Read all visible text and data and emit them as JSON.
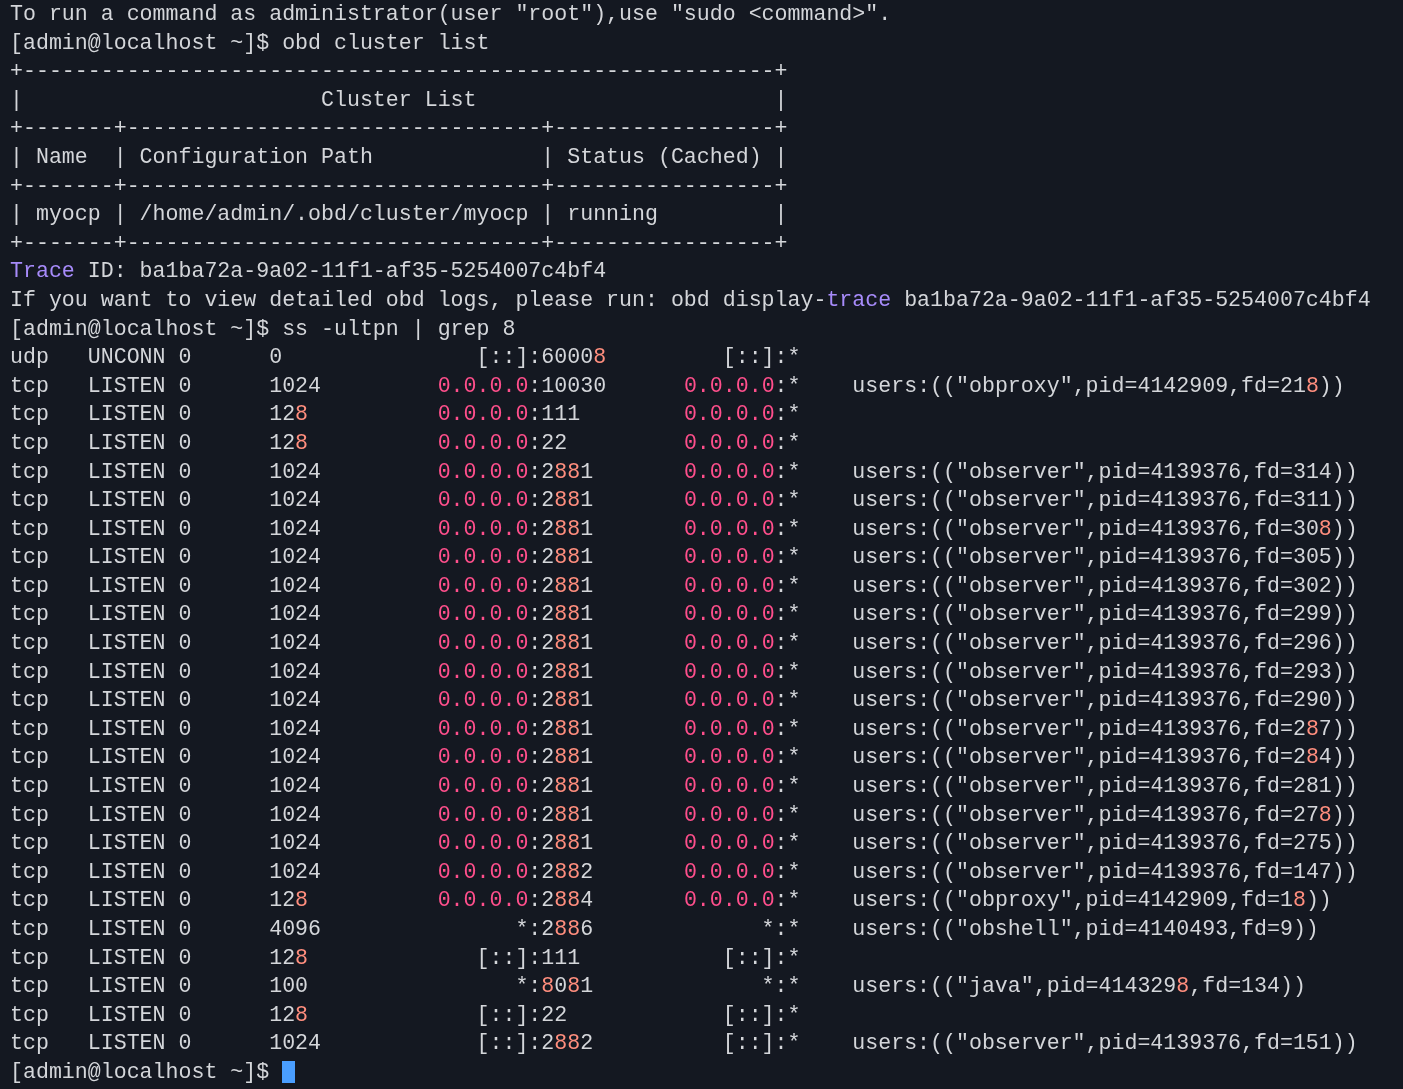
{
  "terminal": {
    "lines": [
      {
        "segments": [
          {
            "kind": "plain",
            "text": "To run a command as administrator(user \"root\"),use \"sudo <command>\"."
          }
        ]
      },
      {
        "segments": [
          {
            "kind": "plain",
            "text": "[admin@localhost ~]$ obd cluster list"
          }
        ]
      },
      {
        "segments": [
          {
            "kind": "plain",
            "text": "+----------------------------------------------------------+"
          }
        ]
      },
      {
        "segments": [
          {
            "kind": "plain",
            "text": "|                       Cluster List                       |"
          }
        ]
      },
      {
        "segments": [
          {
            "kind": "plain",
            "text": "+-------+--------------------------------+-----------------+"
          }
        ]
      },
      {
        "segments": [
          {
            "kind": "plain",
            "text": "| Name  | Configuration Path             | Status (Cached) |"
          }
        ]
      },
      {
        "segments": [
          {
            "kind": "plain",
            "text": "+-------+--------------------------------+-----------------+"
          }
        ]
      },
      {
        "segments": [
          {
            "kind": "plain",
            "text": "| myocp | /home/admin/.obd/cluster/myocp | running         |"
          }
        ]
      },
      {
        "segments": [
          {
            "kind": "plain",
            "text": "+-------+--------------------------------+-----------------+"
          }
        ]
      },
      {
        "segments": [
          {
            "kind": "keyword",
            "text": "Trace"
          },
          {
            "kind": "plain",
            "text": " ID: ba1ba72a-9a02-11f1-af35-5254007c4bf4"
          }
        ]
      },
      {
        "segments": [
          {
            "kind": "plain",
            "text": "If you want to view detailed obd logs, please run: obd display-"
          },
          {
            "kind": "keyword",
            "text": "trace"
          },
          {
            "kind": "plain",
            "text": " ba1ba72a-9a02-11f1-af35-5254007c4bf4"
          }
        ]
      },
      {
        "segments": [
          {
            "kind": "plain",
            "text": "[admin@localhost ~]$ ss -ultpn | grep 8"
          }
        ]
      },
      {
        "segments": [
          {
            "kind": "plain",
            "text": "udp   UNCONN 0      0               [::]:6000"
          },
          {
            "kind": "match",
            "text": "8"
          },
          {
            "kind": "plain",
            "text": "         [::]:*"
          }
        ]
      },
      {
        "segments": [
          {
            "kind": "plain",
            "text": "tcp   LISTEN 0      1024         "
          },
          {
            "kind": "ip",
            "text": "0.0.0.0"
          },
          {
            "kind": "plain",
            "text": ":10030      "
          },
          {
            "kind": "ip",
            "text": "0.0.0.0"
          },
          {
            "kind": "plain",
            "text": ":*    users:((\"obproxy\",pid=4142909,fd=21"
          },
          {
            "kind": "match",
            "text": "8"
          },
          {
            "kind": "plain",
            "text": "))"
          }
        ]
      },
      {
        "segments": [
          {
            "kind": "plain",
            "text": "tcp   LISTEN 0      12"
          },
          {
            "kind": "match",
            "text": "8"
          },
          {
            "kind": "ip",
            "text": "          0.0.0.0"
          },
          {
            "kind": "plain",
            "text": ":111        "
          },
          {
            "kind": "ip",
            "text": "0.0.0.0"
          },
          {
            "kind": "plain",
            "text": ":*"
          }
        ]
      },
      {
        "segments": [
          {
            "kind": "plain",
            "text": "tcp   LISTEN 0      12"
          },
          {
            "kind": "match",
            "text": "8"
          },
          {
            "kind": "ip",
            "text": "          0.0.0.0"
          },
          {
            "kind": "plain",
            "text": ":22         "
          },
          {
            "kind": "ip",
            "text": "0.0.0.0"
          },
          {
            "kind": "plain",
            "text": ":*"
          }
        ]
      },
      {
        "segments": [
          {
            "kind": "plain",
            "text": "tcp   LISTEN 0      1024         "
          },
          {
            "kind": "ip",
            "text": "0.0.0.0"
          },
          {
            "kind": "plain",
            "text": ":2"
          },
          {
            "kind": "match",
            "text": "88"
          },
          {
            "kind": "plain",
            "text": "1       "
          },
          {
            "kind": "ip",
            "text": "0.0.0.0"
          },
          {
            "kind": "plain",
            "text": ":*    users:((\"observer\",pid=4139376,fd=314))"
          }
        ]
      },
      {
        "segments": [
          {
            "kind": "plain",
            "text": "tcp   LISTEN 0      1024         "
          },
          {
            "kind": "ip",
            "text": "0.0.0.0"
          },
          {
            "kind": "plain",
            "text": ":2"
          },
          {
            "kind": "match",
            "text": "88"
          },
          {
            "kind": "plain",
            "text": "1       "
          },
          {
            "kind": "ip",
            "text": "0.0.0.0"
          },
          {
            "kind": "plain",
            "text": ":*    users:((\"observer\",pid=4139376,fd=311))"
          }
        ]
      },
      {
        "segments": [
          {
            "kind": "plain",
            "text": "tcp   LISTEN 0      1024         "
          },
          {
            "kind": "ip",
            "text": "0.0.0.0"
          },
          {
            "kind": "plain",
            "text": ":2"
          },
          {
            "kind": "match",
            "text": "88"
          },
          {
            "kind": "plain",
            "text": "1       "
          },
          {
            "kind": "ip",
            "text": "0.0.0.0"
          },
          {
            "kind": "plain",
            "text": ":*    users:((\"observer\",pid=4139376,fd=30"
          },
          {
            "kind": "match",
            "text": "8"
          },
          {
            "kind": "plain",
            "text": "))"
          }
        ]
      },
      {
        "segments": [
          {
            "kind": "plain",
            "text": "tcp   LISTEN 0      1024         "
          },
          {
            "kind": "ip",
            "text": "0.0.0.0"
          },
          {
            "kind": "plain",
            "text": ":2"
          },
          {
            "kind": "match",
            "text": "88"
          },
          {
            "kind": "plain",
            "text": "1       "
          },
          {
            "kind": "ip",
            "text": "0.0.0.0"
          },
          {
            "kind": "plain",
            "text": ":*    users:((\"observer\",pid=4139376,fd=305))"
          }
        ]
      },
      {
        "segments": [
          {
            "kind": "plain",
            "text": "tcp   LISTEN 0      1024         "
          },
          {
            "kind": "ip",
            "text": "0.0.0.0"
          },
          {
            "kind": "plain",
            "text": ":2"
          },
          {
            "kind": "match",
            "text": "88"
          },
          {
            "kind": "plain",
            "text": "1       "
          },
          {
            "kind": "ip",
            "text": "0.0.0.0"
          },
          {
            "kind": "plain",
            "text": ":*    users:((\"observer\",pid=4139376,fd=302))"
          }
        ]
      },
      {
        "segments": [
          {
            "kind": "plain",
            "text": "tcp   LISTEN 0      1024         "
          },
          {
            "kind": "ip",
            "text": "0.0.0.0"
          },
          {
            "kind": "plain",
            "text": ":2"
          },
          {
            "kind": "match",
            "text": "88"
          },
          {
            "kind": "plain",
            "text": "1       "
          },
          {
            "kind": "ip",
            "text": "0.0.0.0"
          },
          {
            "kind": "plain",
            "text": ":*    users:((\"observer\",pid=4139376,fd=299))"
          }
        ]
      },
      {
        "segments": [
          {
            "kind": "plain",
            "text": "tcp   LISTEN 0      1024         "
          },
          {
            "kind": "ip",
            "text": "0.0.0.0"
          },
          {
            "kind": "plain",
            "text": ":2"
          },
          {
            "kind": "match",
            "text": "88"
          },
          {
            "kind": "plain",
            "text": "1       "
          },
          {
            "kind": "ip",
            "text": "0.0.0.0"
          },
          {
            "kind": "plain",
            "text": ":*    users:((\"observer\",pid=4139376,fd=296))"
          }
        ]
      },
      {
        "segments": [
          {
            "kind": "plain",
            "text": "tcp   LISTEN 0      1024         "
          },
          {
            "kind": "ip",
            "text": "0.0.0.0"
          },
          {
            "kind": "plain",
            "text": ":2"
          },
          {
            "kind": "match",
            "text": "88"
          },
          {
            "kind": "plain",
            "text": "1       "
          },
          {
            "kind": "ip",
            "text": "0.0.0.0"
          },
          {
            "kind": "plain",
            "text": ":*    users:((\"observer\",pid=4139376,fd=293))"
          }
        ]
      },
      {
        "segments": [
          {
            "kind": "plain",
            "text": "tcp   LISTEN 0      1024         "
          },
          {
            "kind": "ip",
            "text": "0.0.0.0"
          },
          {
            "kind": "plain",
            "text": ":2"
          },
          {
            "kind": "match",
            "text": "88"
          },
          {
            "kind": "plain",
            "text": "1       "
          },
          {
            "kind": "ip",
            "text": "0.0.0.0"
          },
          {
            "kind": "plain",
            "text": ":*    users:((\"observer\",pid=4139376,fd=290))"
          }
        ]
      },
      {
        "segments": [
          {
            "kind": "plain",
            "text": "tcp   LISTEN 0      1024         "
          },
          {
            "kind": "ip",
            "text": "0.0.0.0"
          },
          {
            "kind": "plain",
            "text": ":2"
          },
          {
            "kind": "match",
            "text": "88"
          },
          {
            "kind": "plain",
            "text": "1       "
          },
          {
            "kind": "ip",
            "text": "0.0.0.0"
          },
          {
            "kind": "plain",
            "text": ":*    users:((\"observer\",pid=4139376,fd=2"
          },
          {
            "kind": "match",
            "text": "8"
          },
          {
            "kind": "plain",
            "text": "7))"
          }
        ]
      },
      {
        "segments": [
          {
            "kind": "plain",
            "text": "tcp   LISTEN 0      1024         "
          },
          {
            "kind": "ip",
            "text": "0.0.0.0"
          },
          {
            "kind": "plain",
            "text": ":2"
          },
          {
            "kind": "match",
            "text": "88"
          },
          {
            "kind": "plain",
            "text": "1       "
          },
          {
            "kind": "ip",
            "text": "0.0.0.0"
          },
          {
            "kind": "plain",
            "text": ":*    users:((\"observer\",pid=4139376,fd=2"
          },
          {
            "kind": "match",
            "text": "8"
          },
          {
            "kind": "plain",
            "text": "4))"
          }
        ]
      },
      {
        "segments": [
          {
            "kind": "plain",
            "text": "tcp   LISTEN 0      1024         "
          },
          {
            "kind": "ip",
            "text": "0.0.0.0"
          },
          {
            "kind": "plain",
            "text": ":2"
          },
          {
            "kind": "match",
            "text": "88"
          },
          {
            "kind": "plain",
            "text": "1       "
          },
          {
            "kind": "ip",
            "text": "0.0.0.0"
          },
          {
            "kind": "plain",
            "text": ":*    users:((\"observer\",pid=4139376,fd=281))"
          }
        ]
      },
      {
        "segments": [
          {
            "kind": "plain",
            "text": "tcp   LISTEN 0      1024         "
          },
          {
            "kind": "ip",
            "text": "0.0.0.0"
          },
          {
            "kind": "plain",
            "text": ":2"
          },
          {
            "kind": "match",
            "text": "88"
          },
          {
            "kind": "plain",
            "text": "1       "
          },
          {
            "kind": "ip",
            "text": "0.0.0.0"
          },
          {
            "kind": "plain",
            "text": ":*    users:((\"observer\",pid=4139376,fd=27"
          },
          {
            "kind": "match",
            "text": "8"
          },
          {
            "kind": "plain",
            "text": "))"
          }
        ]
      },
      {
        "segments": [
          {
            "kind": "plain",
            "text": "tcp   LISTEN 0      1024         "
          },
          {
            "kind": "ip",
            "text": "0.0.0.0"
          },
          {
            "kind": "plain",
            "text": ":2"
          },
          {
            "kind": "match",
            "text": "88"
          },
          {
            "kind": "plain",
            "text": "1       "
          },
          {
            "kind": "ip",
            "text": "0.0.0.0"
          },
          {
            "kind": "plain",
            "text": ":*    users:((\"observer\",pid=4139376,fd=275))"
          }
        ]
      },
      {
        "segments": [
          {
            "kind": "plain",
            "text": "tcp   LISTEN 0      1024         "
          },
          {
            "kind": "ip",
            "text": "0.0.0.0"
          },
          {
            "kind": "plain",
            "text": ":2"
          },
          {
            "kind": "match",
            "text": "88"
          },
          {
            "kind": "plain",
            "text": "2       "
          },
          {
            "kind": "ip",
            "text": "0.0.0.0"
          },
          {
            "kind": "plain",
            "text": ":*    users:((\"observer\",pid=4139376,fd=147))"
          }
        ]
      },
      {
        "segments": [
          {
            "kind": "plain",
            "text": "tcp   LISTEN 0      12"
          },
          {
            "kind": "match",
            "text": "8"
          },
          {
            "kind": "ip",
            "text": "          0.0.0.0"
          },
          {
            "kind": "plain",
            "text": ":2"
          },
          {
            "kind": "match",
            "text": "88"
          },
          {
            "kind": "plain",
            "text": "4       "
          },
          {
            "kind": "ip",
            "text": "0.0.0.0"
          },
          {
            "kind": "plain",
            "text": ":*    users:((\"obproxy\",pid=4142909,fd=1"
          },
          {
            "kind": "match",
            "text": "8"
          },
          {
            "kind": "plain",
            "text": "))"
          }
        ]
      },
      {
        "segments": [
          {
            "kind": "plain",
            "text": "tcp   LISTEN 0      4096               *:2"
          },
          {
            "kind": "match",
            "text": "88"
          },
          {
            "kind": "plain",
            "text": "6             *:*    users:((\"obshell\",pid=4140493,fd=9))"
          }
        ]
      },
      {
        "segments": [
          {
            "kind": "plain",
            "text": "tcp   LISTEN 0      12"
          },
          {
            "kind": "match",
            "text": "8"
          },
          {
            "kind": "plain",
            "text": "             [::]:111           [::]:*"
          }
        ]
      },
      {
        "segments": [
          {
            "kind": "plain",
            "text": "tcp   LISTEN 0      100                *:"
          },
          {
            "kind": "match",
            "text": "8"
          },
          {
            "kind": "plain",
            "text": "0"
          },
          {
            "kind": "match",
            "text": "8"
          },
          {
            "kind": "plain",
            "text": "1             *:*    users:((\"java\",pid=414329"
          },
          {
            "kind": "match",
            "text": "8"
          },
          {
            "kind": "plain",
            "text": ",fd=134))"
          }
        ]
      },
      {
        "segments": [
          {
            "kind": "plain",
            "text": "tcp   LISTEN 0      12"
          },
          {
            "kind": "match",
            "text": "8"
          },
          {
            "kind": "plain",
            "text": "             [::]:22            [::]:*"
          }
        ]
      },
      {
        "segments": [
          {
            "kind": "plain",
            "text": "tcp   LISTEN 0      1024            [::]:2"
          },
          {
            "kind": "match",
            "text": "88"
          },
          {
            "kind": "plain",
            "text": "2          [::]:*    users:((\"observer\",pid=4139376,fd=151))"
          }
        ]
      },
      {
        "segments": [
          {
            "kind": "plain",
            "text": "[admin@localhost ~]$ "
          }
        ],
        "cursor": true
      }
    ]
  }
}
